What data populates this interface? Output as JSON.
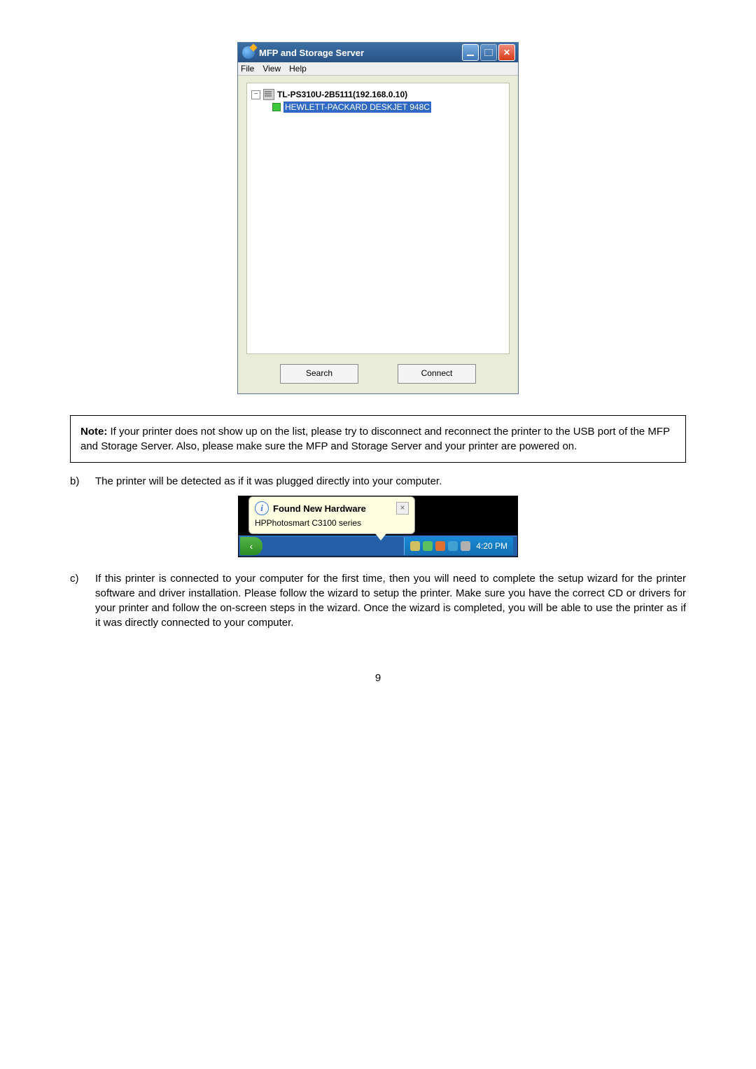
{
  "mfp_window": {
    "title": "MFP and Storage Server",
    "menus": [
      "File",
      "View",
      "Help"
    ],
    "tree": {
      "root_label": "TL-PS310U-2B5111(192.168.0.10)",
      "child_label": "HEWLETT-PACKARD  DESKJET 948C"
    },
    "buttons": {
      "search": "Search",
      "connect": "Connect"
    },
    "expander_glyph": "−"
  },
  "note": {
    "title": "Note:",
    "body": "If your printer does not show up on the list, please try to disconnect and reconnect the printer to the USB port of the MFP and Storage Server. Also, please make sure the MFP and Storage Server and your printer are powered on."
  },
  "step_b": {
    "marker": "b)",
    "text": "The printer will be detected as if it was plugged directly into your computer."
  },
  "balloon": {
    "title": "Found New Hardware",
    "body": "HPPhotosmart C3100 series",
    "close_glyph": "×",
    "info_glyph": "i"
  },
  "taskbar": {
    "start_glyph": "‹",
    "clock": "4:20 PM"
  },
  "step_c": {
    "marker": "c)",
    "text": "If this printer is connected to your computer for the first time, then you will need to complete the setup wizard for the printer software and driver installation. Please follow the wizard to setup the printer. Make sure you have the correct CD or drivers for your printer and follow the on-screen steps in the wizard. Once the wizard is completed, you will be able to use the printer as if it was directly connected to your computer."
  },
  "page_number": "9"
}
